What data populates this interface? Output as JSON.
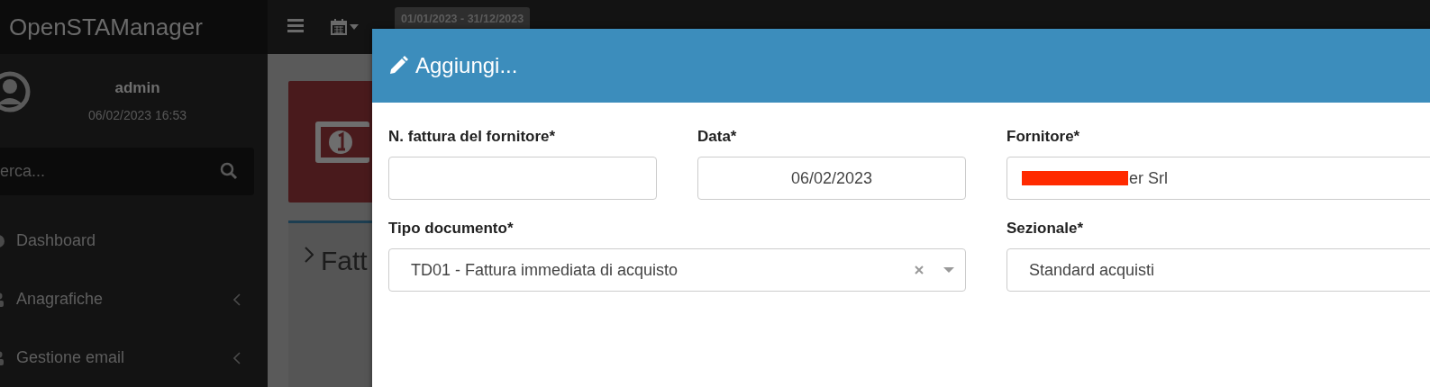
{
  "app": {
    "title": "OpenSTAManager"
  },
  "topbar": {
    "date_range": "01/01/2023 - 31/12/2023"
  },
  "user": {
    "name": "admin",
    "timestamp": "06/02/2023 16:53"
  },
  "sidebar": {
    "search": {
      "placeholder": "erca..."
    },
    "items": [
      {
        "label": "Dashboard",
        "has_submenu": false
      },
      {
        "label": "Anagrafiche",
        "has_submenu": true
      },
      {
        "label": "Gestione email",
        "has_submenu": true
      }
    ]
  },
  "content": {
    "box_title": "Fatt"
  },
  "modal": {
    "title": "Aggiungi...",
    "fields": [
      {
        "label": "N. fattura del fornitore*",
        "kind": "input"
      },
      {
        "label": "Data*",
        "kind": "input",
        "value": "06/02/2023"
      },
      {
        "label": "Fornitore*",
        "kind": "select",
        "value": "er Srl",
        "redacted": true
      },
      {
        "label": "Tipo documento*",
        "kind": "select",
        "value": "TD01 - Fattura immediata di acquisto",
        "clearable": true
      },
      {
        "label": "Sezionale*",
        "kind": "select",
        "value": "Standard acquisti"
      }
    ]
  }
}
